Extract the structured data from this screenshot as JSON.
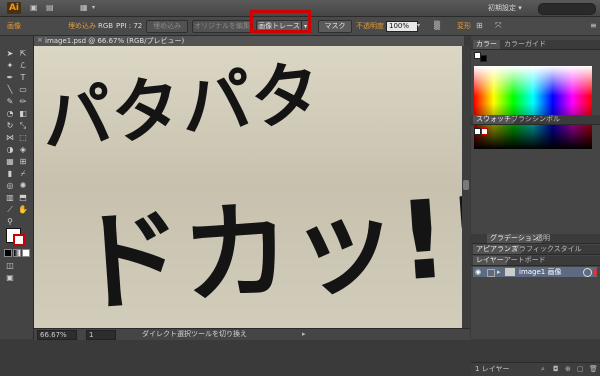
{
  "titlebar": {
    "app_logo": "Ai",
    "workspace": "初期設定",
    "workspace_arrow": "▾"
  },
  "controlbar": {
    "left_label": "画像",
    "embed_label": "埋め込み",
    "color_info": "RGB",
    "ppi_info": "PPI : 72",
    "embed_btn": "埋め込み",
    "edit_original_btn": "オリジナルを編集",
    "image_trace_btn": "画像トレース",
    "mask_btn": "マスク",
    "opacity_label": "不透明度 :",
    "opacity_value": "100%",
    "transform_label": "変形",
    "dropdown_arrow": "▾"
  },
  "document": {
    "tab_label": "image1.psd @ 66.67% (RGB/プレビュー)",
    "zoom": "66.67%",
    "page": "1",
    "status": "ダイレクト選択ツールを切り換え",
    "artwork_line1": "パタパタ",
    "artwork_line2": "ドカッ!!"
  },
  "panels": {
    "color_tabs": [
      "カラー",
      "カラーガイド"
    ],
    "swatch_tabs": [
      "スウォッチ",
      "ブラシ",
      "シンボル"
    ],
    "gradient_tabs": [
      "グラデーション",
      "透明"
    ],
    "appearance_tabs": [
      "アピアランス",
      "グラフィックスタイル"
    ],
    "layers_tabs": [
      "レイヤー",
      "アートボード"
    ],
    "layer_name": "image1 画像",
    "layer_count": "1 レイヤー"
  },
  "colors": {
    "accent": "#e09b3a",
    "highlight": "#d00000",
    "layer_row": "#5d6b82"
  }
}
